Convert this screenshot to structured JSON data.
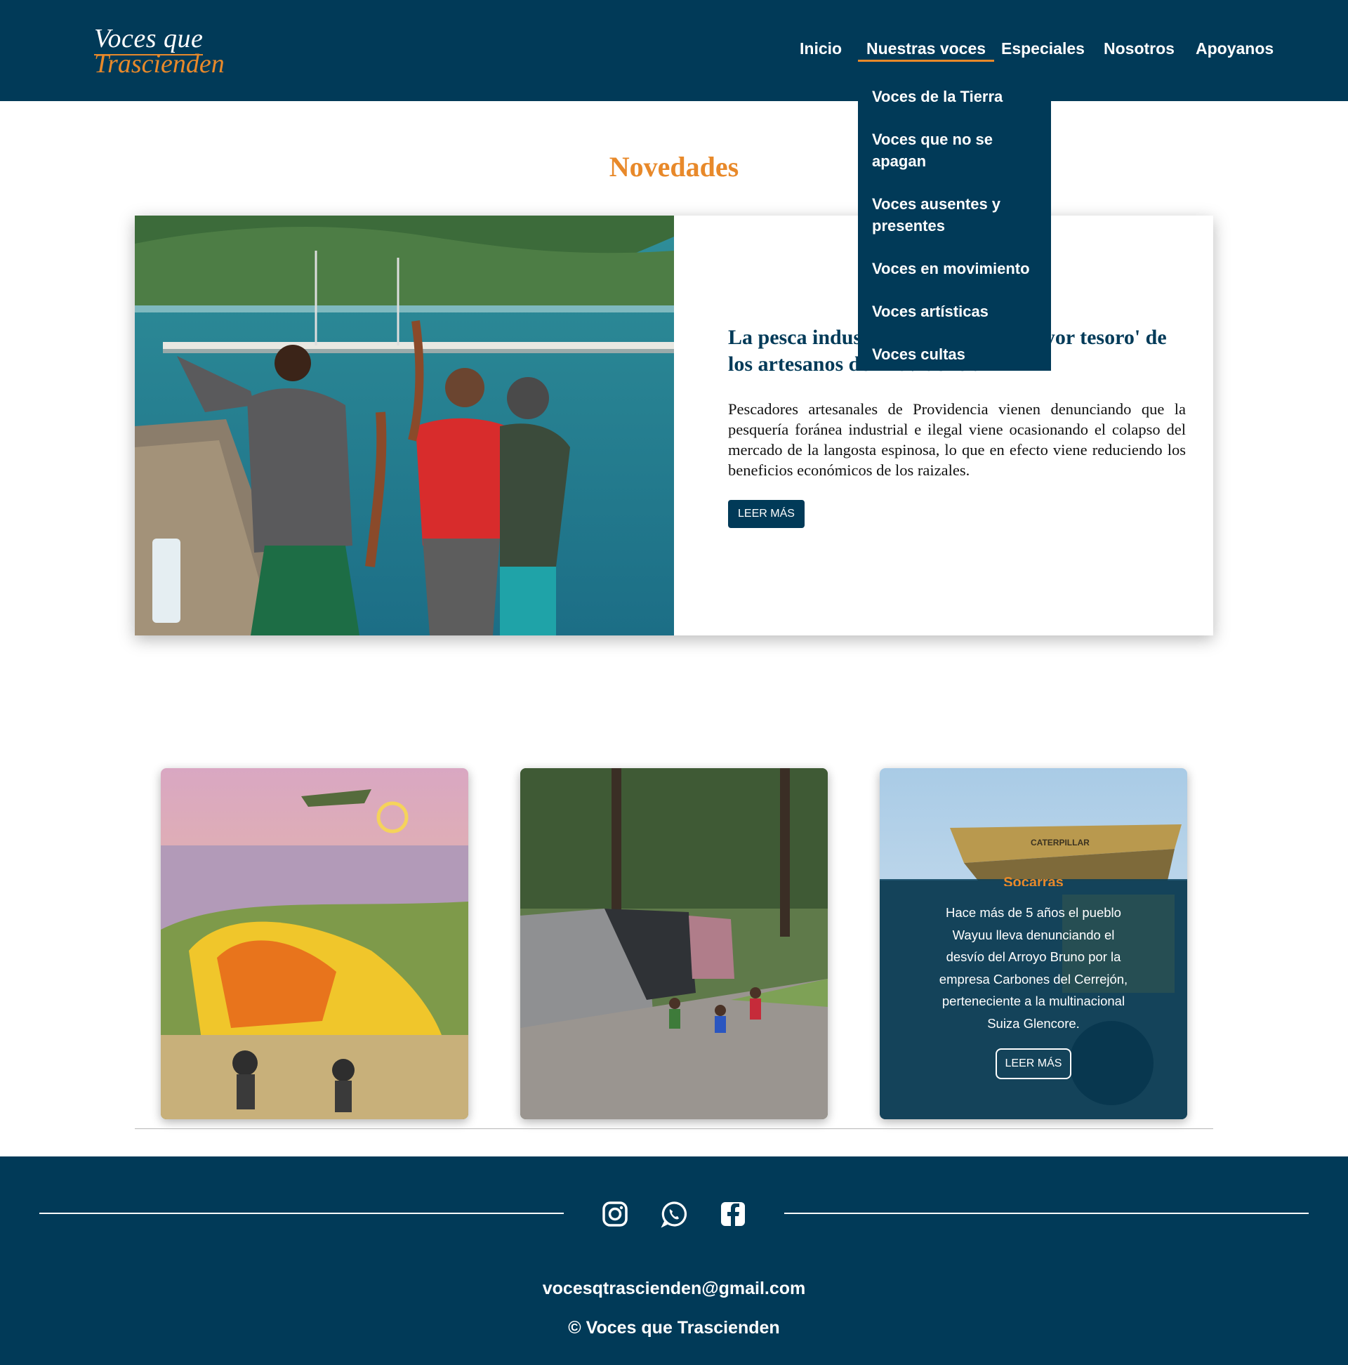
{
  "site": {
    "logo_line1": "Voces que",
    "logo_line2": "Trascienden"
  },
  "nav": {
    "items": [
      {
        "label": "Inicio"
      },
      {
        "label": "Nuestras voces",
        "active": true
      },
      {
        "label": "Especiales"
      },
      {
        "label": "Nosotros"
      },
      {
        "label": "Apoyanos"
      }
    ],
    "dropdown": [
      {
        "label": "Voces de la Tierra"
      },
      {
        "label": "Voces que no se apagan"
      },
      {
        "label": "Voces ausentes y presentes"
      },
      {
        "label": "Voces en movimiento"
      },
      {
        "label": "Voces artísticas"
      },
      {
        "label": "Voces cultas"
      }
    ]
  },
  "featured": {
    "section_title": "Novedades",
    "title": "La pesca industrial amenaza el 'mayor tesoro' de los artesanos de Providencia",
    "body": "Pescadores artesanales de Providencia vienen denunciando que la pesquería foránea industrial e ilegal viene ocasionando el colapso del mercado de la langosta espinosa, lo que en efecto viene reduciendo los beneficios económicos de los raizales.",
    "button": "LEER MÁS"
  },
  "cards": [
    {
      "image": "forest-fire-illustration"
    },
    {
      "image": "tent-camp-photo"
    },
    {
      "image": "mining-truck-photo",
      "overlay_heading": "Socarras",
      "overlay_text": "Hace más de 5 años el pueblo Wayuu lleva denunciando el desvío del Arroyo Bruno por la empresa Carbones del Cerrejón, perteneciente a la multinacional Suiza Glencore.",
      "button": "LEER MÁS",
      "truck_label": "CATERPILLAR"
    }
  ],
  "footer": {
    "social": [
      "instagram-icon",
      "whatsapp-icon",
      "facebook-icon"
    ],
    "email": "vocesqtrascienden@gmail.com",
    "copyright": "© Voces que Trascienden"
  },
  "colors": {
    "navy": "#013a58",
    "accent": "#e8892a",
    "white": "#ffffff"
  }
}
